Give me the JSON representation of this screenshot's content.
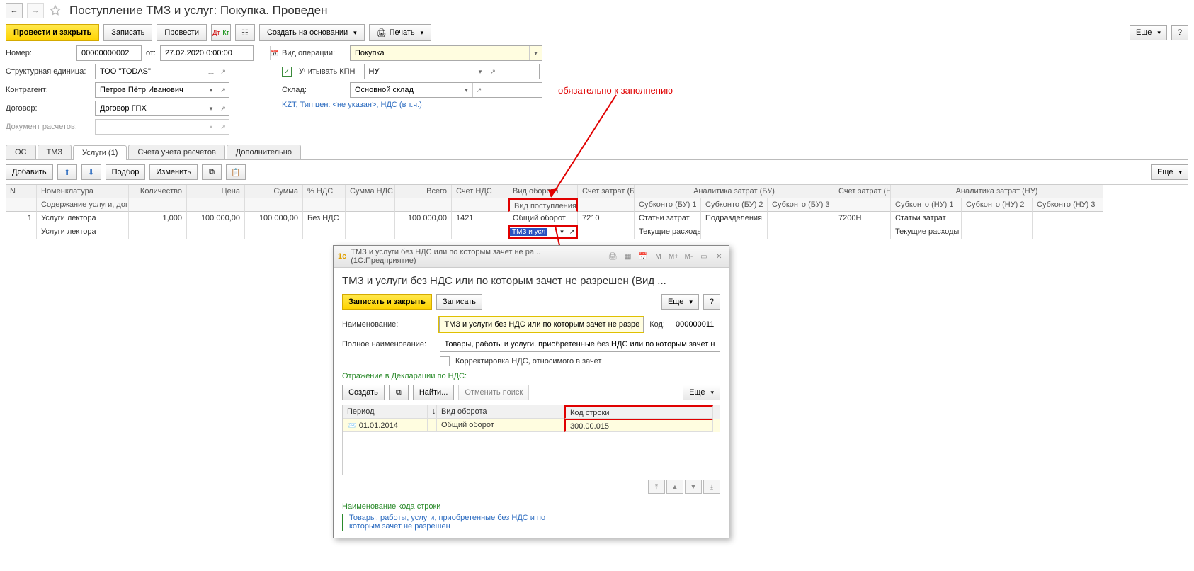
{
  "page_title": "Поступление ТМЗ и услуг: Покупка. Проведен",
  "toolbar": {
    "post_close": "Провести и закрыть",
    "save": "Записать",
    "post": "Провести",
    "create_based": "Создать на основании",
    "print": "Печать",
    "more": "Еще"
  },
  "annotations": {
    "required_text": "обязательно к заполнению"
  },
  "form": {
    "number_label": "Номер:",
    "number_value": "00000000002",
    "from_label": "от:",
    "date_value": "27.02.2020 0:00:00",
    "org_label": "Структурная единица:",
    "org_value": "ТОО \"TODAS\"",
    "contragent_label": "Контрагент:",
    "contragent_value": "Петров Пётр Иванович",
    "contract_label": "Договор:",
    "contract_value": "Договор ГПХ",
    "settlement_doc_label": "Документ расчетов:",
    "settlement_doc_value": "",
    "op_type_label": "Вид операции:",
    "op_type_value": "Покупка",
    "kpn_label": "Учитывать КПН",
    "kpn_value": "НУ",
    "warehouse_label": "Склад:",
    "warehouse_value": "Основной склад",
    "currency_line": "KZT, Тип цен: <не указан>, НДС (в т.ч.)"
  },
  "tabs": [
    "ОС",
    "ТМЗ",
    "Услуги (1)",
    "Счета учета расчетов",
    "Дополнительно"
  ],
  "sub_toolbar": {
    "add": "Добавить",
    "pick": "Подбор",
    "edit": "Изменить",
    "more": "Еще"
  },
  "grid": {
    "headers": {
      "n": "N",
      "nomen": "Номенклатура",
      "nomen_sub": "Содержание услуги, доп.",
      "qty": "Количество",
      "price": "Цена",
      "sum": "Сумма",
      "vat_pct": "% НДС",
      "vat_sum": "Сумма НДС",
      "total": "Всего",
      "vat_acc": "Счет НДС",
      "turnover": "Вид оборота",
      "turnover_sub": "Вид поступления",
      "cost_acc_bu": "Счет затрат (БУ)",
      "analytics_bu": "Аналитика затрат (БУ)",
      "sub_bu1": "Субконто (БУ) 1",
      "sub_bu2": "Субконто (БУ) 2",
      "sub_bu3": "Субконто (БУ) 3",
      "cost_acc_nu": "Счет затрат (НУ)",
      "analytics_nu": "Аналитика затрат (НУ)",
      "sub_nu1": "Субконто (НУ) 1",
      "sub_nu2": "Субконто (НУ) 2",
      "sub_nu3": "Субконто (НУ) 3"
    },
    "row": {
      "n": "1",
      "nomen1": "Услуги лектора",
      "nomen2": "Услуги лектора",
      "qty": "1,000",
      "price": "100 000,00",
      "sum": "100 000,00",
      "vat_pct": "Без НДС",
      "vat_sum": "",
      "total": "100 000,00",
      "vat_acc": "1421",
      "turnover1": "Общий оборот",
      "turnover2_sel": "ТМЗ и усл",
      "cost_acc_bu": "7210",
      "sub_bu1_a": "Статьи затрат",
      "sub_bu1_b": "Текущие расходы",
      "sub_bu2_a": "Подразделения",
      "cost_acc_nu": "7200Н",
      "sub_nu1_a": "Статьи затрат",
      "sub_nu1_b": "Текущие расходы"
    }
  },
  "popup": {
    "titlebar": "ТМЗ и услуги без НДС или по которым зачет не ра...  (1С:Предприятие)",
    "heading": "ТМЗ и услуги без НДС или по которым зачет не разрешен (Вид ...",
    "save_close": "Записать и закрыть",
    "save": "Записать",
    "more": "Еще",
    "name_label": "Наименование:",
    "name_value": "ТМЗ и услуги без НДС или по которым зачет не разрешен",
    "code_label": "Код:",
    "code_value": "000000011",
    "full_name_label": "Полное наименование:",
    "full_name_value": "Товары, работы и услуги, приобретенные без НДС или по которым зачет не разрешен",
    "adj_vat_label": "Корректировка НДС, относимого в зачет",
    "decl_heading": "Отражение в Декларации по НДС:",
    "create": "Создать",
    "find": "Найти...",
    "cancel_find": "Отменить поиск",
    "grid_headers": {
      "period": "Период",
      "turnover": "Вид оборота",
      "row_code": "Код строки"
    },
    "grid_row": {
      "period": "01.01.2014",
      "turnover": "Общий оборот",
      "row_code": "300.00.015"
    },
    "footer_caption": "Наименование кода строки",
    "footer_desc": "Товары, работы, услуги, приобретенные без НДС и по которым зачет не разрешен"
  }
}
